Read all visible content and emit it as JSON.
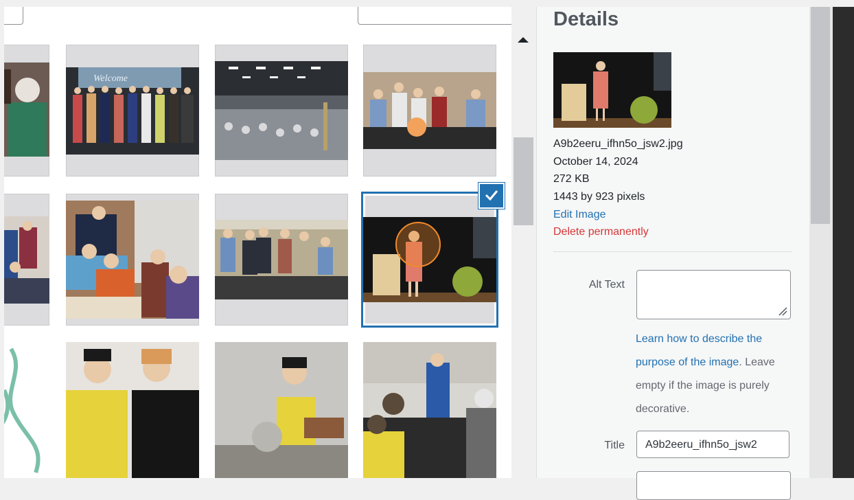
{
  "details": {
    "title": "Details",
    "filename": "A9b2eeru_ifhn5o_jsw2.jpg",
    "date": "October 14, 2024",
    "filesize": "272 KB",
    "dimensions": "1443 by 923 pixels",
    "edit_link": "Edit Image",
    "delete_link": "Delete permanently"
  },
  "fields": {
    "alt_text_label": "Alt Text",
    "alt_text_value": "",
    "help_link": "Learn how to describe the purpose of the image",
    "help_rest": ". Leave empty if the image is purely decorative.",
    "title_label": "Title",
    "title_value": "A9b2eeru_ifhn5o_jsw2"
  },
  "grid": {
    "selected_index": 7,
    "items": [
      {
        "icon": "photo-icon"
      },
      {
        "icon": "photo-icon",
        "caption": "Welcome"
      },
      {
        "icon": "photo-icon"
      },
      {
        "icon": "photo-icon"
      },
      {
        "icon": "photo-icon"
      },
      {
        "icon": "photo-icon"
      },
      {
        "icon": "photo-icon"
      },
      {
        "icon": "photo-icon"
      },
      {
        "icon": "photo-icon"
      },
      {
        "icon": "photo-icon"
      },
      {
        "icon": "photo-icon"
      },
      {
        "icon": "photo-icon"
      }
    ]
  },
  "colors": {
    "accent": "#2271b1",
    "danger": "#d63638"
  }
}
